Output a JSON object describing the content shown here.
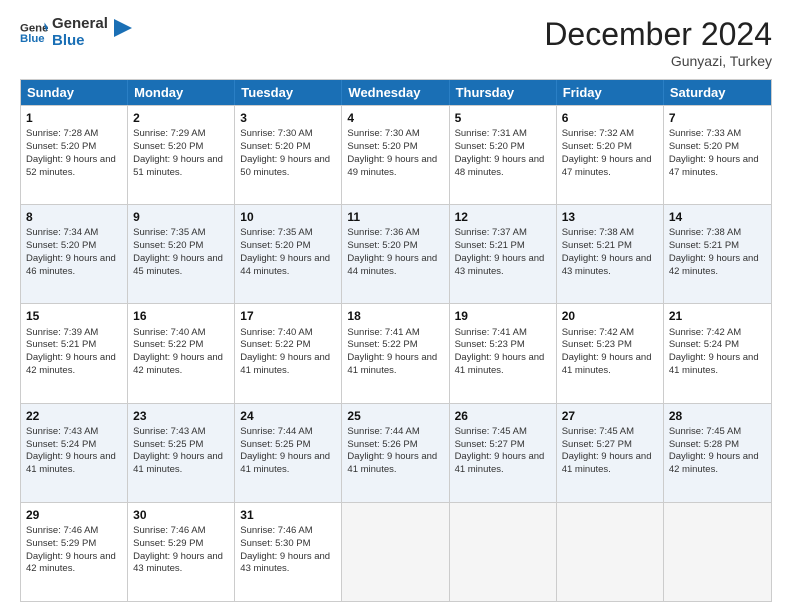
{
  "logo": {
    "line1": "General",
    "line2": "Blue"
  },
  "header": {
    "month": "December 2024",
    "location": "Gunyazi, Turkey"
  },
  "weekdays": [
    "Sunday",
    "Monday",
    "Tuesday",
    "Wednesday",
    "Thursday",
    "Friday",
    "Saturday"
  ],
  "rows": [
    {
      "alt": false,
      "cells": [
        {
          "day": "1",
          "sunrise": "Sunrise: 7:28 AM",
          "sunset": "Sunset: 5:20 PM",
          "daylight": "Daylight: 9 hours and 52 minutes."
        },
        {
          "day": "2",
          "sunrise": "Sunrise: 7:29 AM",
          "sunset": "Sunset: 5:20 PM",
          "daylight": "Daylight: 9 hours and 51 minutes."
        },
        {
          "day": "3",
          "sunrise": "Sunrise: 7:30 AM",
          "sunset": "Sunset: 5:20 PM",
          "daylight": "Daylight: 9 hours and 50 minutes."
        },
        {
          "day": "4",
          "sunrise": "Sunrise: 7:30 AM",
          "sunset": "Sunset: 5:20 PM",
          "daylight": "Daylight: 9 hours and 49 minutes."
        },
        {
          "day": "5",
          "sunrise": "Sunrise: 7:31 AM",
          "sunset": "Sunset: 5:20 PM",
          "daylight": "Daylight: 9 hours and 48 minutes."
        },
        {
          "day": "6",
          "sunrise": "Sunrise: 7:32 AM",
          "sunset": "Sunset: 5:20 PM",
          "daylight": "Daylight: 9 hours and 47 minutes."
        },
        {
          "day": "7",
          "sunrise": "Sunrise: 7:33 AM",
          "sunset": "Sunset: 5:20 PM",
          "daylight": "Daylight: 9 hours and 47 minutes."
        }
      ]
    },
    {
      "alt": true,
      "cells": [
        {
          "day": "8",
          "sunrise": "Sunrise: 7:34 AM",
          "sunset": "Sunset: 5:20 PM",
          "daylight": "Daylight: 9 hours and 46 minutes."
        },
        {
          "day": "9",
          "sunrise": "Sunrise: 7:35 AM",
          "sunset": "Sunset: 5:20 PM",
          "daylight": "Daylight: 9 hours and 45 minutes."
        },
        {
          "day": "10",
          "sunrise": "Sunrise: 7:35 AM",
          "sunset": "Sunset: 5:20 PM",
          "daylight": "Daylight: 9 hours and 44 minutes."
        },
        {
          "day": "11",
          "sunrise": "Sunrise: 7:36 AM",
          "sunset": "Sunset: 5:20 PM",
          "daylight": "Daylight: 9 hours and 44 minutes."
        },
        {
          "day": "12",
          "sunrise": "Sunrise: 7:37 AM",
          "sunset": "Sunset: 5:21 PM",
          "daylight": "Daylight: 9 hours and 43 minutes."
        },
        {
          "day": "13",
          "sunrise": "Sunrise: 7:38 AM",
          "sunset": "Sunset: 5:21 PM",
          "daylight": "Daylight: 9 hours and 43 minutes."
        },
        {
          "day": "14",
          "sunrise": "Sunrise: 7:38 AM",
          "sunset": "Sunset: 5:21 PM",
          "daylight": "Daylight: 9 hours and 42 minutes."
        }
      ]
    },
    {
      "alt": false,
      "cells": [
        {
          "day": "15",
          "sunrise": "Sunrise: 7:39 AM",
          "sunset": "Sunset: 5:21 PM",
          "daylight": "Daylight: 9 hours and 42 minutes."
        },
        {
          "day": "16",
          "sunrise": "Sunrise: 7:40 AM",
          "sunset": "Sunset: 5:22 PM",
          "daylight": "Daylight: 9 hours and 42 minutes."
        },
        {
          "day": "17",
          "sunrise": "Sunrise: 7:40 AM",
          "sunset": "Sunset: 5:22 PM",
          "daylight": "Daylight: 9 hours and 41 minutes."
        },
        {
          "day": "18",
          "sunrise": "Sunrise: 7:41 AM",
          "sunset": "Sunset: 5:22 PM",
          "daylight": "Daylight: 9 hours and 41 minutes."
        },
        {
          "day": "19",
          "sunrise": "Sunrise: 7:41 AM",
          "sunset": "Sunset: 5:23 PM",
          "daylight": "Daylight: 9 hours and 41 minutes."
        },
        {
          "day": "20",
          "sunrise": "Sunrise: 7:42 AM",
          "sunset": "Sunset: 5:23 PM",
          "daylight": "Daylight: 9 hours and 41 minutes."
        },
        {
          "day": "21",
          "sunrise": "Sunrise: 7:42 AM",
          "sunset": "Sunset: 5:24 PM",
          "daylight": "Daylight: 9 hours and 41 minutes."
        }
      ]
    },
    {
      "alt": true,
      "cells": [
        {
          "day": "22",
          "sunrise": "Sunrise: 7:43 AM",
          "sunset": "Sunset: 5:24 PM",
          "daylight": "Daylight: 9 hours and 41 minutes."
        },
        {
          "day": "23",
          "sunrise": "Sunrise: 7:43 AM",
          "sunset": "Sunset: 5:25 PM",
          "daylight": "Daylight: 9 hours and 41 minutes."
        },
        {
          "day": "24",
          "sunrise": "Sunrise: 7:44 AM",
          "sunset": "Sunset: 5:25 PM",
          "daylight": "Daylight: 9 hours and 41 minutes."
        },
        {
          "day": "25",
          "sunrise": "Sunrise: 7:44 AM",
          "sunset": "Sunset: 5:26 PM",
          "daylight": "Daylight: 9 hours and 41 minutes."
        },
        {
          "day": "26",
          "sunrise": "Sunrise: 7:45 AM",
          "sunset": "Sunset: 5:27 PM",
          "daylight": "Daylight: 9 hours and 41 minutes."
        },
        {
          "day": "27",
          "sunrise": "Sunrise: 7:45 AM",
          "sunset": "Sunset: 5:27 PM",
          "daylight": "Daylight: 9 hours and 41 minutes."
        },
        {
          "day": "28",
          "sunrise": "Sunrise: 7:45 AM",
          "sunset": "Sunset: 5:28 PM",
          "daylight": "Daylight: 9 hours and 42 minutes."
        }
      ]
    },
    {
      "alt": false,
      "cells": [
        {
          "day": "29",
          "sunrise": "Sunrise: 7:46 AM",
          "sunset": "Sunset: 5:29 PM",
          "daylight": "Daylight: 9 hours and 42 minutes."
        },
        {
          "day": "30",
          "sunrise": "Sunrise: 7:46 AM",
          "sunset": "Sunset: 5:29 PM",
          "daylight": "Daylight: 9 hours and 43 minutes."
        },
        {
          "day": "31",
          "sunrise": "Sunrise: 7:46 AM",
          "sunset": "Sunset: 5:30 PM",
          "daylight": "Daylight: 9 hours and 43 minutes."
        },
        {
          "day": "",
          "sunrise": "",
          "sunset": "",
          "daylight": ""
        },
        {
          "day": "",
          "sunrise": "",
          "sunset": "",
          "daylight": ""
        },
        {
          "day": "",
          "sunrise": "",
          "sunset": "",
          "daylight": ""
        },
        {
          "day": "",
          "sunrise": "",
          "sunset": "",
          "daylight": ""
        }
      ]
    }
  ]
}
